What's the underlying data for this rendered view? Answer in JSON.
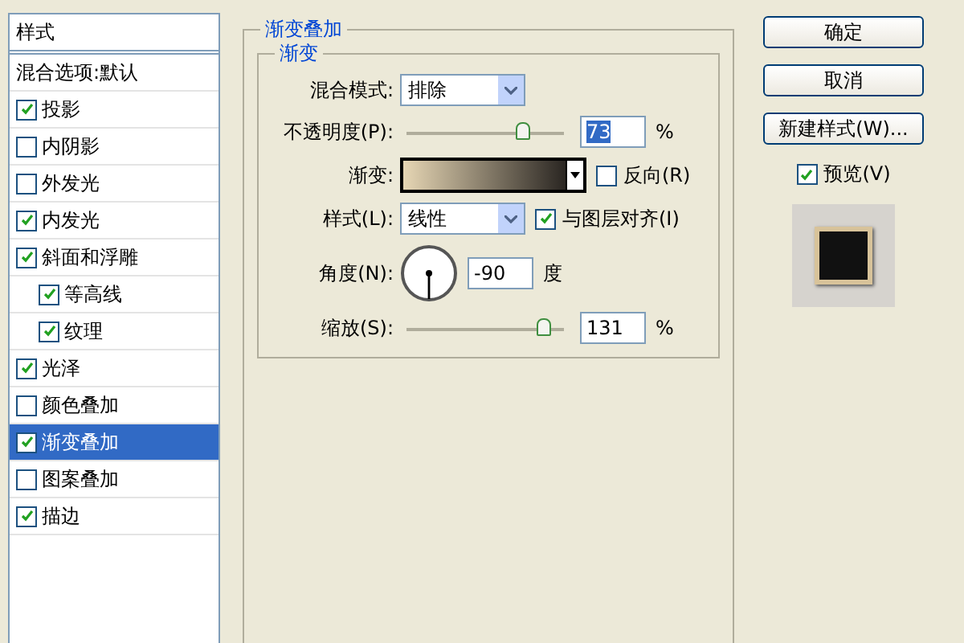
{
  "style_list": {
    "header": "样式",
    "items": [
      {
        "kind": "plain",
        "label": "混合选项:默认",
        "selected": false
      },
      {
        "kind": "check",
        "label": "投影",
        "checked": true,
        "selected": false
      },
      {
        "kind": "check",
        "label": "内阴影",
        "checked": false,
        "selected": false
      },
      {
        "kind": "check",
        "label": "外发光",
        "checked": false,
        "selected": false
      },
      {
        "kind": "check",
        "label": "内发光",
        "checked": true,
        "selected": false
      },
      {
        "kind": "check",
        "label": "斜面和浮雕",
        "checked": true,
        "selected": false,
        "children": [
          {
            "kind": "check",
            "label": "等高线",
            "checked": true,
            "selected": false
          },
          {
            "kind": "check",
            "label": "纹理",
            "checked": true,
            "selected": false
          }
        ]
      },
      {
        "kind": "check",
        "label": "光泽",
        "checked": true,
        "selected": false
      },
      {
        "kind": "check",
        "label": "颜色叠加",
        "checked": false,
        "selected": false
      },
      {
        "kind": "check",
        "label": "渐变叠加",
        "checked": true,
        "selected": true
      },
      {
        "kind": "check",
        "label": "图案叠加",
        "checked": false,
        "selected": false
      },
      {
        "kind": "check",
        "label": "描边",
        "checked": true,
        "selected": false
      }
    ]
  },
  "panel": {
    "title": "渐变叠加",
    "group": {
      "title": "渐变",
      "blend_mode": {
        "label": "混合模式:",
        "value": "排除"
      },
      "opacity": {
        "label": "不透明度(P):",
        "level": 0.73,
        "value": "73",
        "value_selected": true,
        "unit": "%"
      },
      "gradient": {
        "label": "渐变:",
        "reverse": {
          "label": "反向(R)",
          "checked": false
        }
      },
      "style": {
        "label": "样式(L):",
        "value": "线性",
        "align": {
          "label": "与图层对齐(I)",
          "checked": true
        }
      },
      "angle": {
        "label": "角度(N):",
        "value": "-90",
        "unit": "度"
      },
      "scale": {
        "label": "缩放(S):",
        "level": 0.87,
        "value": "131",
        "unit": "%"
      }
    }
  },
  "buttons": [
    "确定",
    "取消",
    "新建样式(W)..."
  ],
  "preview": {
    "label": "预览(V)",
    "checked": true
  }
}
